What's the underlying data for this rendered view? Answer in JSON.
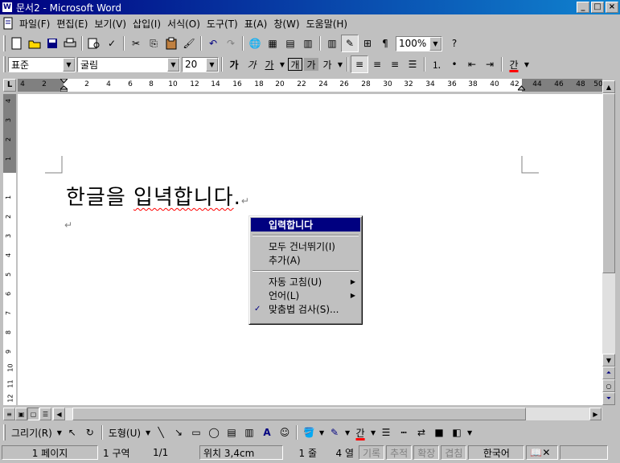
{
  "window": {
    "title": "문서2 - Microsoft Word",
    "icon": "word-document-icon"
  },
  "menu": {
    "items": [
      "파일(F)",
      "편집(E)",
      "보기(V)",
      "삽입(I)",
      "서식(O)",
      "도구(T)",
      "표(A)",
      "창(W)",
      "도움말(H)"
    ]
  },
  "formatting": {
    "style": "표준",
    "font": "굴림",
    "size": "20",
    "bold_label": "가",
    "italic_label": "가",
    "underline_label": "가",
    "border_label": "개",
    "shading_label": "가",
    "phonetic_label": "가",
    "font_color_label": "간"
  },
  "standard": {
    "zoom": "100%"
  },
  "ruler": {
    "labels": [
      "4",
      "2",
      "2",
      "4",
      "6",
      "8",
      "10",
      "12",
      "14",
      "16",
      "18",
      "20",
      "22",
      "24",
      "26",
      "28",
      "30",
      "32",
      "34",
      "36",
      "38",
      "40",
      "42",
      "44",
      "46",
      "48",
      "50"
    ]
  },
  "vruler": {
    "labels": [
      "4",
      "3",
      "2",
      "1",
      "1",
      "2",
      "3",
      "4",
      "5",
      "6",
      "7",
      "8",
      "9",
      "10",
      "11",
      "12"
    ]
  },
  "document": {
    "before_underline": "한글을 ",
    "underlined": "입녁합니다",
    "after": ".",
    "para_mark": "↵"
  },
  "context_menu": {
    "suggestion": "입력합니다",
    "ignore_all": "모두 건너뛰기(I)",
    "add": "추가(A)",
    "autocorrect": "자동 고침(U)",
    "language": "언어(L)",
    "spelling": "맞춤법 검사(S)..."
  },
  "drawing": {
    "draw_menu": "그리기(R)",
    "autoshapes": "도형(U)",
    "font_color_label": "간"
  },
  "status": {
    "page": "1 페이지",
    "section": "1 구역",
    "page_of": "1/1",
    "position": "위치 3,4cm",
    "line": "1 줄",
    "column": "4 열",
    "rec": "기록",
    "trk": "추적",
    "ext": "확장",
    "ovr": "겹침",
    "language": "한국어"
  },
  "colors": {
    "titlebar": "#000080",
    "selection": "#000080",
    "squiggle": "#ff0000",
    "chrome": "#c0c0c0"
  }
}
